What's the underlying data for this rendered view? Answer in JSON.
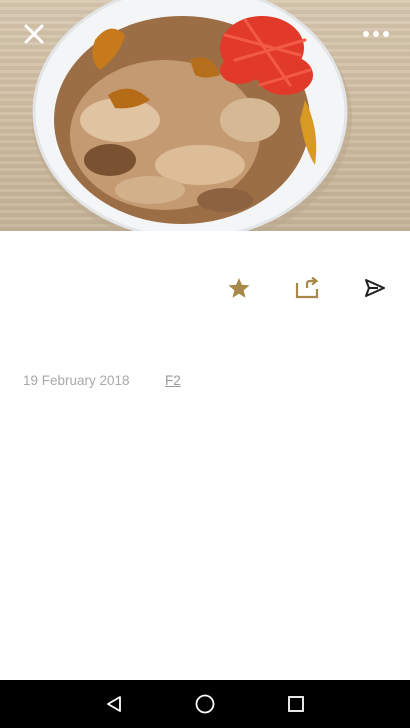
{
  "photo": {
    "subject": "gyudon bowl with pickled red ginger"
  },
  "top_bar": {
    "close_icon": "close-icon",
    "more_icon": "more-dots-icon"
  },
  "actions": {
    "favorite_icon": "star-icon",
    "share_icon": "share-out-icon",
    "send_icon": "send-icon",
    "accent_color": "#a8894a"
  },
  "meta": {
    "date": "19 February 2018",
    "folder": "F2"
  },
  "navbar": {
    "back_icon": "back-triangle-icon",
    "home_icon": "home-circle-icon",
    "recent_icon": "recent-square-icon"
  }
}
